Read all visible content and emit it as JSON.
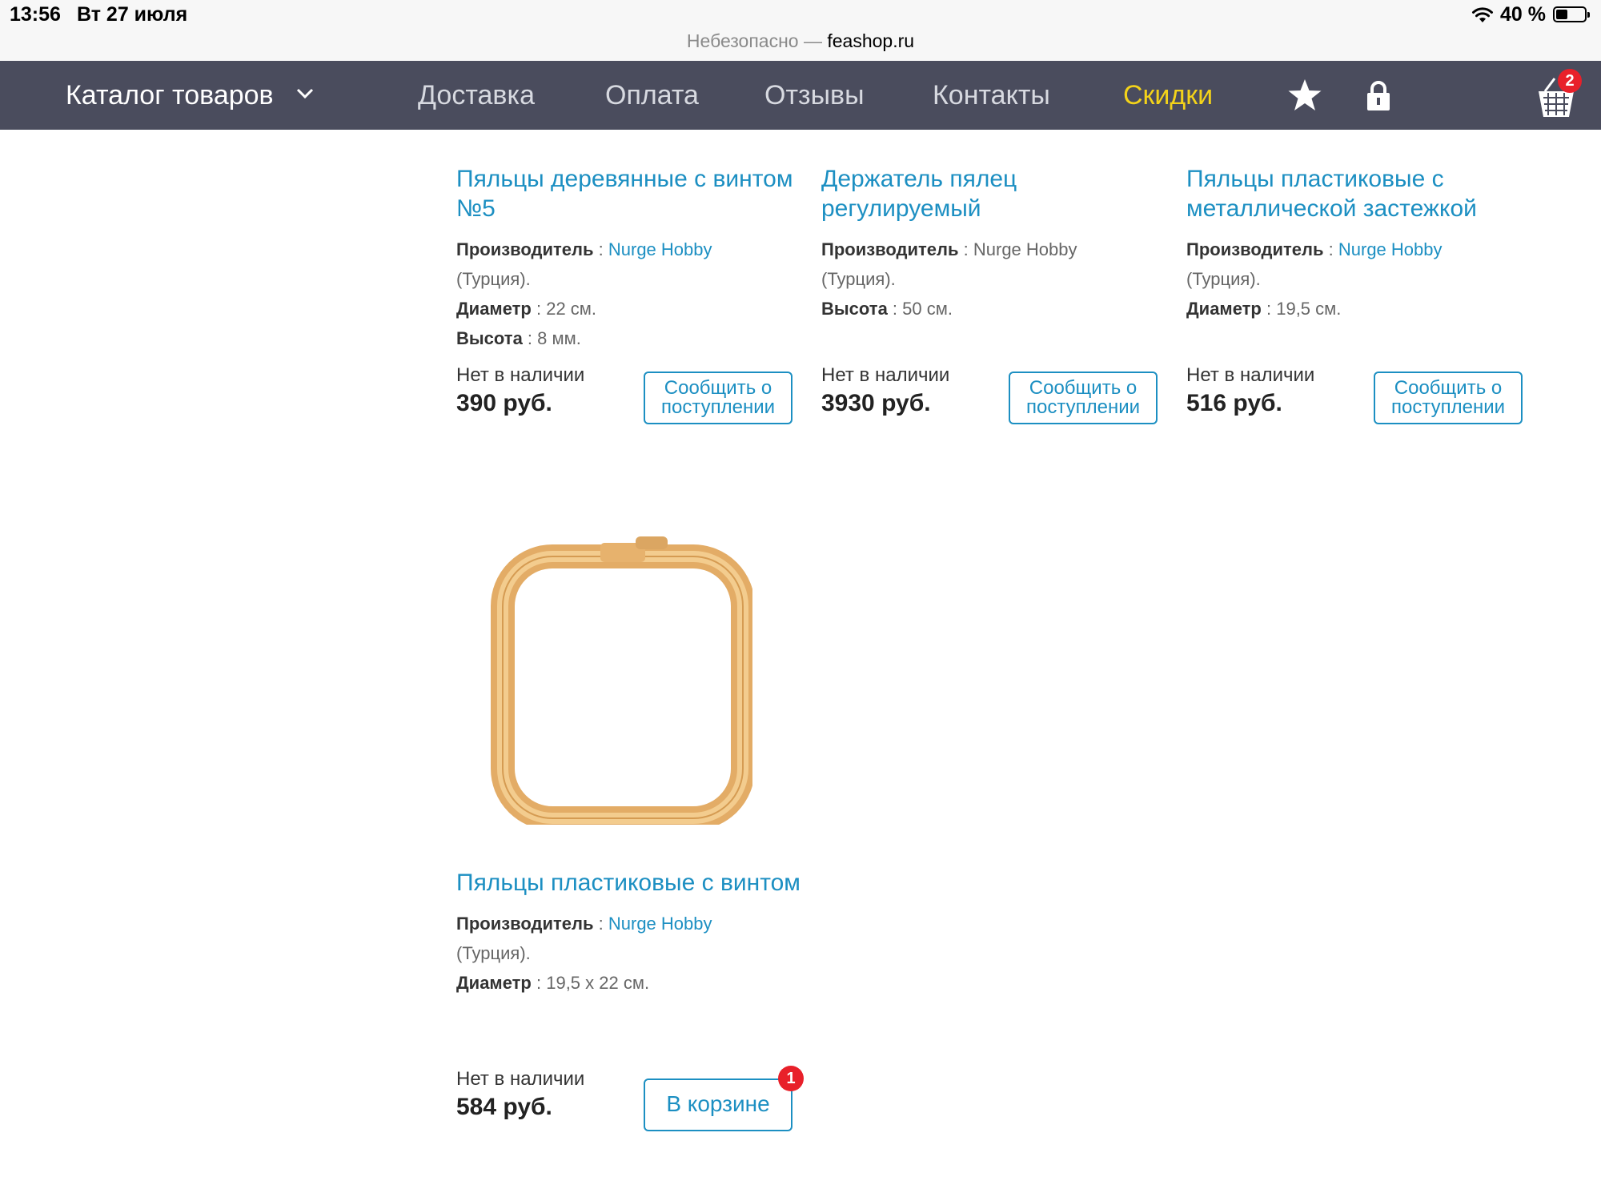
{
  "status_bar": {
    "time": "13:56",
    "date": "Вт 27 июля",
    "url_prefix": "Небезопасно — ",
    "url_host": "feashop.ru",
    "battery": "40 %"
  },
  "nav": {
    "catalog": "Каталог товаров",
    "links": [
      "Доставка",
      "Оплата",
      "Отзывы",
      "Контакты",
      "Скидки"
    ],
    "cart_count": "2",
    "icons": [
      "chevron-down-icon",
      "star-icon",
      "lock-icon",
      "cart-icon"
    ],
    "accent_color": "#f3d31a",
    "bar_color": "#4a4c5d"
  },
  "labels": {
    "manufacturer": "Производитель",
    "diameter": "Диаметр",
    "height": "Высота",
    "separator": " : "
  },
  "products": [
    {
      "title": "Пяльцы деревянные с винтом №5",
      "manufacturer": "Nurge Hobby",
      "country": "(Турция).",
      "diameter": "22 см.",
      "height": "8 мм.",
      "stock": "Нет в наличии",
      "price": "390 руб.",
      "button": "Сообщить о поступлении"
    },
    {
      "title": "Держатель пялец регулируемый",
      "manufacturer": "Nurge Hobby",
      "country": "(Турция).",
      "height": "50 см.",
      "stock": "Нет в наличии",
      "price": "3930 руб.",
      "button": "Сообщить о поступлении"
    },
    {
      "title": "Пяльцы пластиковые с металлической застежкой",
      "manufacturer": "Nurge Hobby",
      "country": "(Турция).",
      "diameter": "19,5 см.",
      "stock": "Нет в наличии",
      "price": "516 руб.",
      "button": "Сообщить о поступлении"
    },
    {
      "title": "Пяльцы пластиковые с винтом",
      "manufacturer": "Nurge Hobby",
      "country": "(Турция).",
      "diameter": "19,5 x 22 см.",
      "stock": "Нет в наличии",
      "price": "584 руб.",
      "button": "В корзине",
      "badge": "1"
    }
  ],
  "colors": {
    "link": "#1c8fc2",
    "badge": "#e8202a"
  }
}
